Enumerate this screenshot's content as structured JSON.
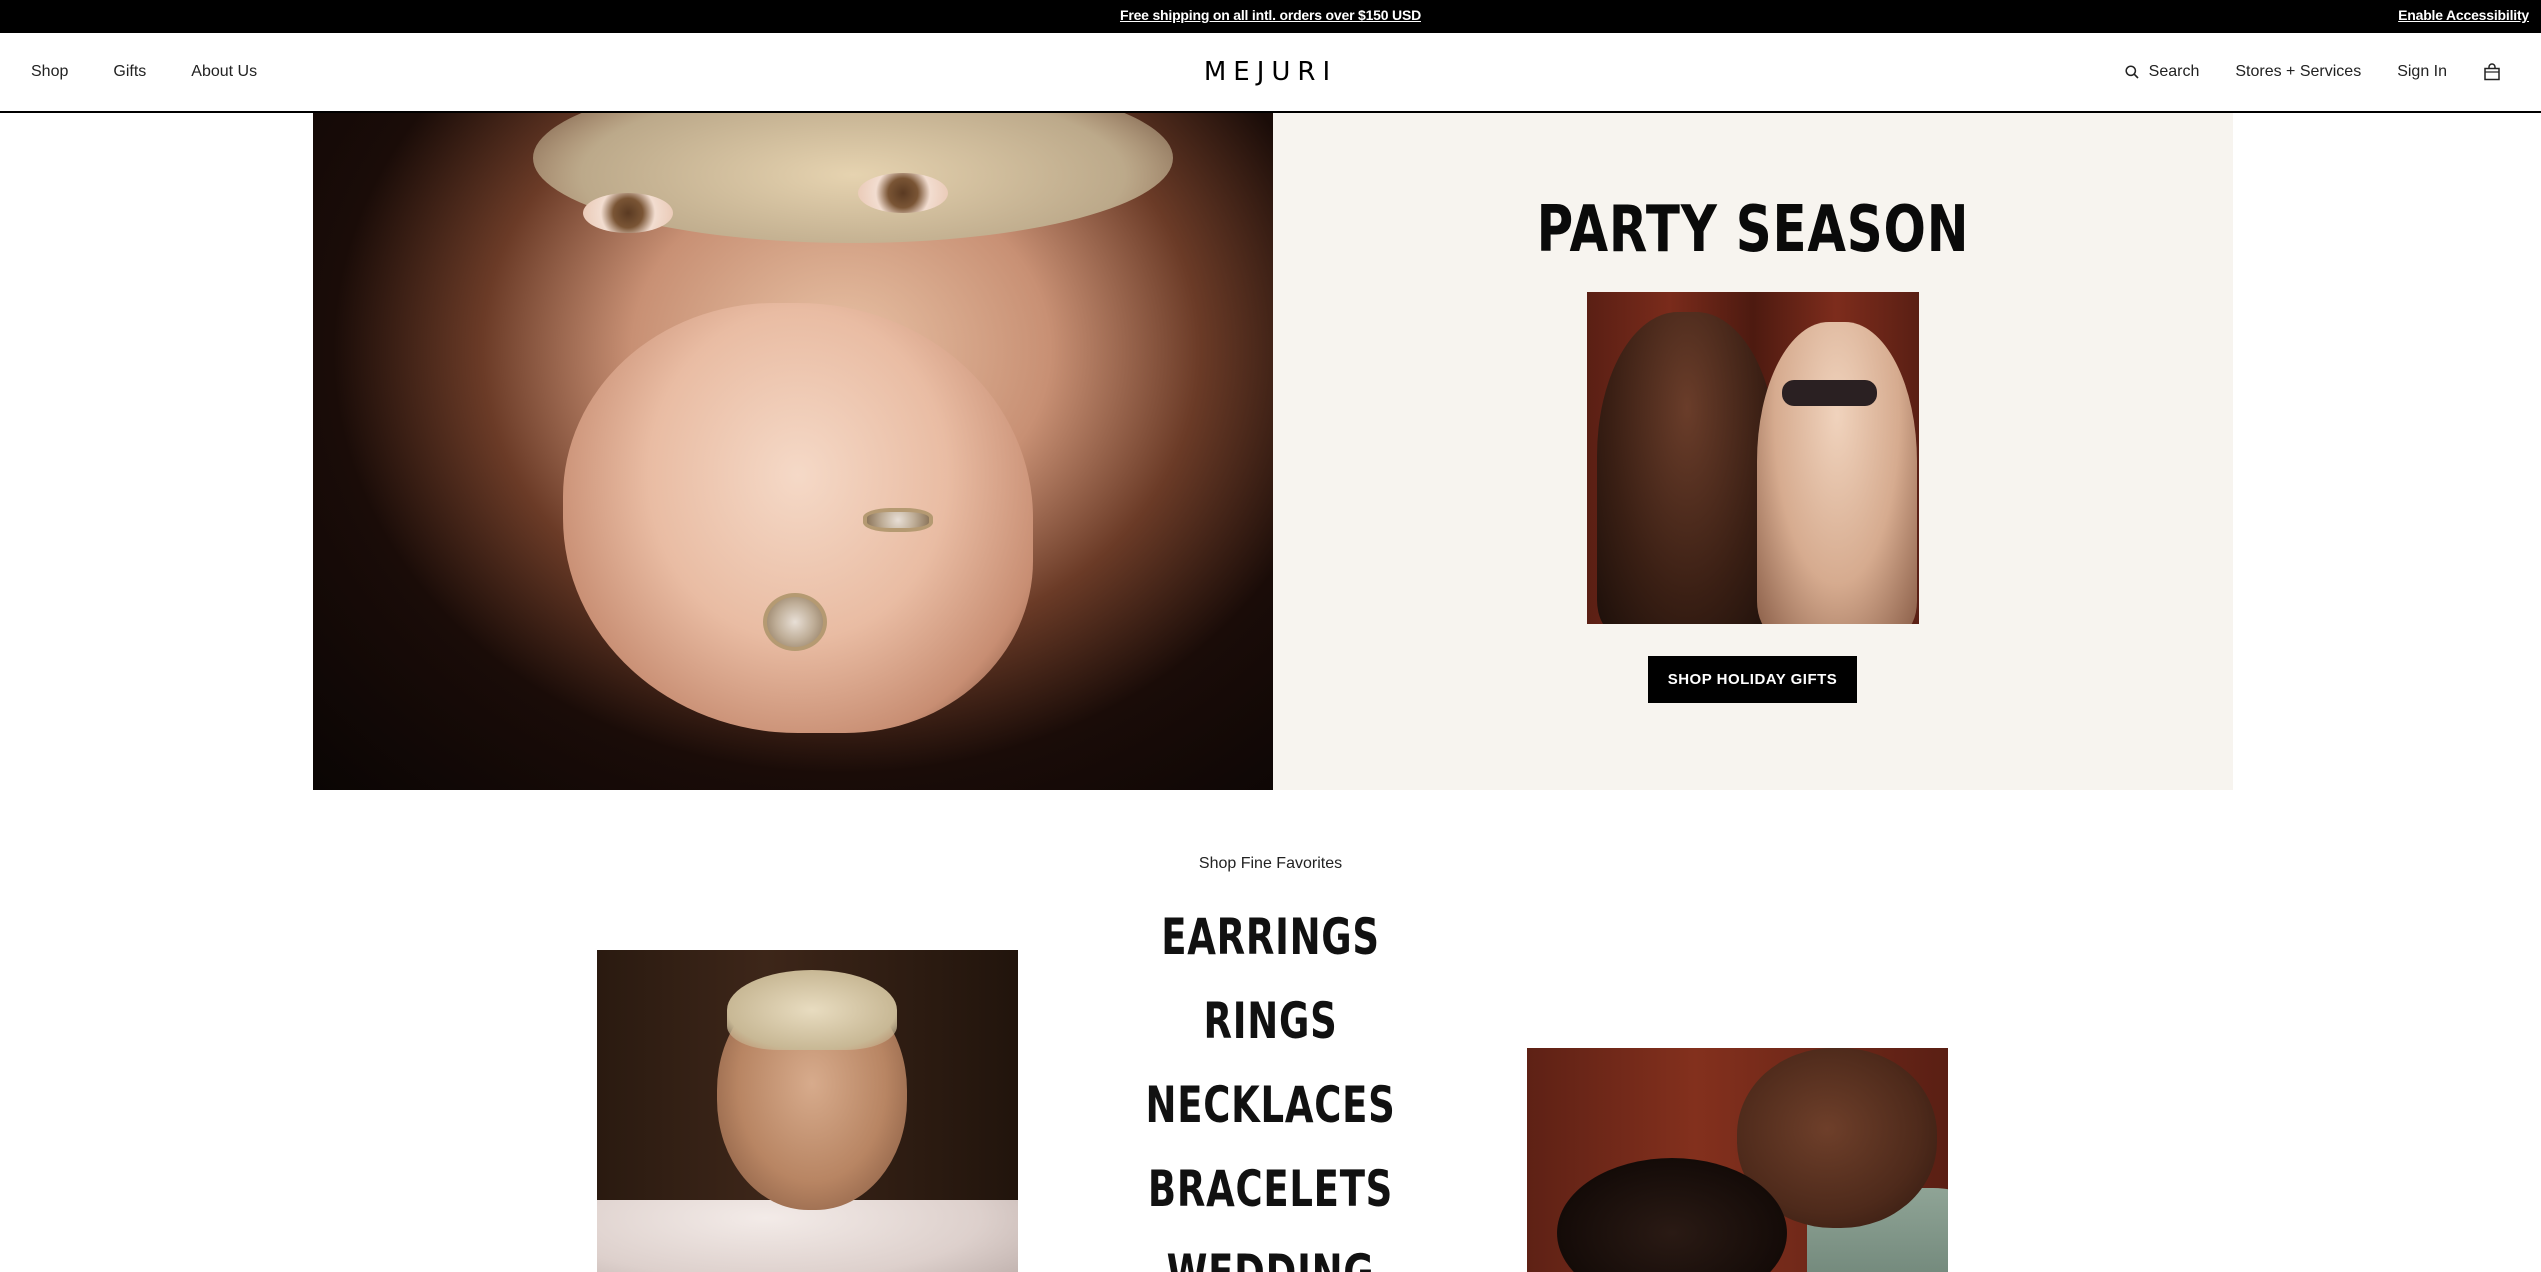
{
  "announcement": {
    "text": "Free shipping on all intl. orders over $150 USD",
    "accessibility_link": "Enable Accessibility"
  },
  "header": {
    "nav_left": [
      "Shop",
      "Gifts",
      "About Us"
    ],
    "logo": "MEJURI",
    "search_label": "Search",
    "stores_label": "Stores + Services",
    "signin_label": "Sign In",
    "icons": {
      "search": "search-icon",
      "bag": "shopping-bag-icon"
    }
  },
  "hero": {
    "title": "PARTY SEASON",
    "cta_label": "SHOP HOLIDAY GIFTS"
  },
  "favorites": {
    "heading": "Shop Fine Favorites",
    "categories": [
      "EARRINGS",
      "RINGS",
      "NECKLACES",
      "BRACELETS",
      "WEDDING"
    ]
  },
  "colors": {
    "announcement_bg": "#000000",
    "hero_panel_bg": "#f7f4ef",
    "cta_bg": "#000000",
    "text": "#111111"
  }
}
